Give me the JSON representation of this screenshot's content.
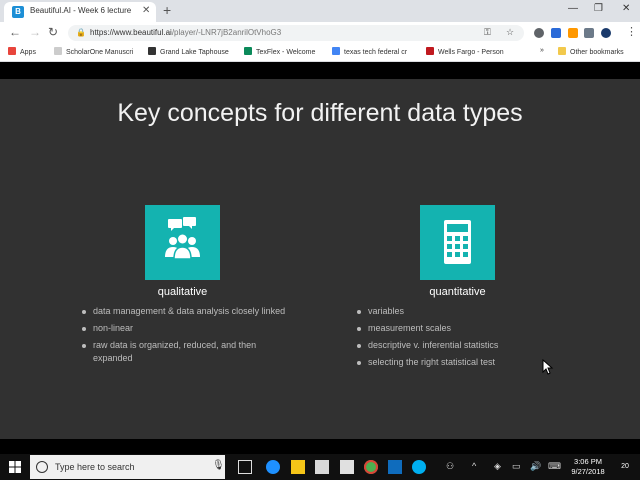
{
  "browser": {
    "tab": {
      "favicon_letter": "B",
      "title": "Beautiful.AI - Week 6 lecture"
    },
    "url_host": "https://www.beautiful.ai",
    "url_path": "/player/-LNR7jB2anrilOtVhoG3",
    "bookmarks": [
      {
        "label": "Apps",
        "color": "#e8453c"
      },
      {
        "label": "ScholarOne Manuscri",
        "color": "#cccccc"
      },
      {
        "label": "Grand Lake Taphouse",
        "color": "#333333"
      },
      {
        "label": "TexFlex - Welcome",
        "color": "#0b8a5a"
      },
      {
        "label": "texas tech federal cr",
        "color": "#4285f4"
      },
      {
        "label": "Wells Fargo - Person",
        "color": "#c0191f"
      },
      {
        "label": "Other bookmarks",
        "color": "#f2c94c"
      }
    ],
    "bookmarks_overflow": "»"
  },
  "slide": {
    "title": "Key concepts for different data types",
    "accent_color": "#14b3b0",
    "columns": [
      {
        "heading": "qualitative",
        "icon": "people-discussion-icon",
        "bullets": [
          "data management & data analysis closely linked",
          "non-linear",
          "raw data is organized, reduced, and then expanded"
        ]
      },
      {
        "heading": "quantitative",
        "icon": "calculator-icon",
        "bullets": [
          "variables",
          "measurement scales",
          "descriptive v. inferential statistics",
          "selecting the right statistical test"
        ]
      }
    ]
  },
  "taskbar": {
    "search_placeholder": "Type here to search",
    "time": "3:06 PM",
    "date": "9/27/2018",
    "notifications": "20"
  }
}
